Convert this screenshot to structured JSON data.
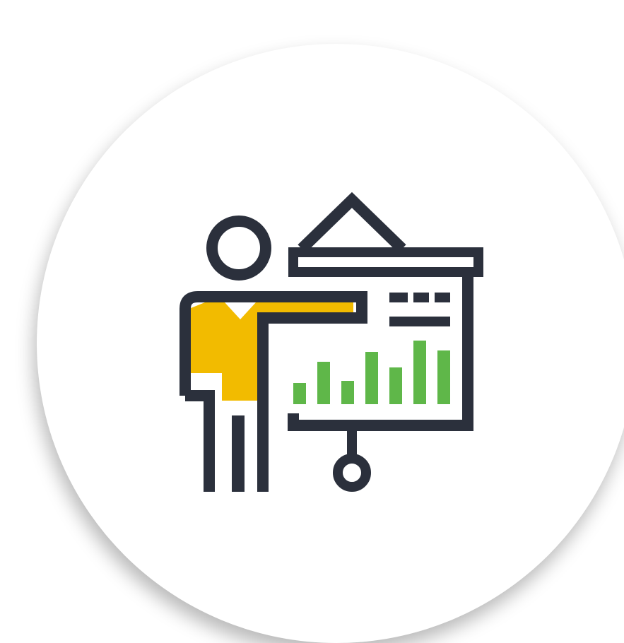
{
  "icon": {
    "name": "presenter-with-chart-icon",
    "colors": {
      "outline": "#2b303c",
      "shirt": "#f2bb00",
      "bars": "#5fb749",
      "background": "#ffffff"
    }
  },
  "chart_data": {
    "type": "bar",
    "categories": [
      "",
      "",
      "",
      "",
      "",
      "",
      ""
    ],
    "values": [
      30,
      60,
      33,
      74,
      52,
      90,
      76
    ],
    "ylim": [
      0,
      100
    ],
    "title": "",
    "xlabel": "",
    "ylabel": ""
  }
}
